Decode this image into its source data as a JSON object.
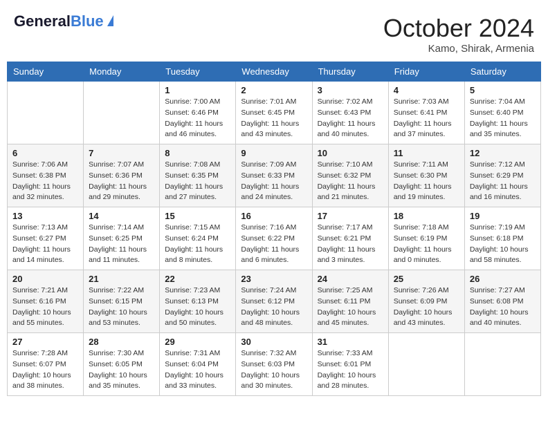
{
  "header": {
    "logo_general": "General",
    "logo_blue": "Blue",
    "month_title": "October 2024",
    "location": "Kamo, Shirak, Armenia"
  },
  "days_of_week": [
    "Sunday",
    "Monday",
    "Tuesday",
    "Wednesday",
    "Thursday",
    "Friday",
    "Saturday"
  ],
  "weeks": [
    [
      {
        "day": "",
        "sunrise": "",
        "sunset": "",
        "daylight": ""
      },
      {
        "day": "",
        "sunrise": "",
        "sunset": "",
        "daylight": ""
      },
      {
        "day": "1",
        "sunrise": "Sunrise: 7:00 AM",
        "sunset": "Sunset: 6:46 PM",
        "daylight": "Daylight: 11 hours and 46 minutes."
      },
      {
        "day": "2",
        "sunrise": "Sunrise: 7:01 AM",
        "sunset": "Sunset: 6:45 PM",
        "daylight": "Daylight: 11 hours and 43 minutes."
      },
      {
        "day": "3",
        "sunrise": "Sunrise: 7:02 AM",
        "sunset": "Sunset: 6:43 PM",
        "daylight": "Daylight: 11 hours and 40 minutes."
      },
      {
        "day": "4",
        "sunrise": "Sunrise: 7:03 AM",
        "sunset": "Sunset: 6:41 PM",
        "daylight": "Daylight: 11 hours and 37 minutes."
      },
      {
        "day": "5",
        "sunrise": "Sunrise: 7:04 AM",
        "sunset": "Sunset: 6:40 PM",
        "daylight": "Daylight: 11 hours and 35 minutes."
      }
    ],
    [
      {
        "day": "6",
        "sunrise": "Sunrise: 7:06 AM",
        "sunset": "Sunset: 6:38 PM",
        "daylight": "Daylight: 11 hours and 32 minutes."
      },
      {
        "day": "7",
        "sunrise": "Sunrise: 7:07 AM",
        "sunset": "Sunset: 6:36 PM",
        "daylight": "Daylight: 11 hours and 29 minutes."
      },
      {
        "day": "8",
        "sunrise": "Sunrise: 7:08 AM",
        "sunset": "Sunset: 6:35 PM",
        "daylight": "Daylight: 11 hours and 27 minutes."
      },
      {
        "day": "9",
        "sunrise": "Sunrise: 7:09 AM",
        "sunset": "Sunset: 6:33 PM",
        "daylight": "Daylight: 11 hours and 24 minutes."
      },
      {
        "day": "10",
        "sunrise": "Sunrise: 7:10 AM",
        "sunset": "Sunset: 6:32 PM",
        "daylight": "Daylight: 11 hours and 21 minutes."
      },
      {
        "day": "11",
        "sunrise": "Sunrise: 7:11 AM",
        "sunset": "Sunset: 6:30 PM",
        "daylight": "Daylight: 11 hours and 19 minutes."
      },
      {
        "day": "12",
        "sunrise": "Sunrise: 7:12 AM",
        "sunset": "Sunset: 6:29 PM",
        "daylight": "Daylight: 11 hours and 16 minutes."
      }
    ],
    [
      {
        "day": "13",
        "sunrise": "Sunrise: 7:13 AM",
        "sunset": "Sunset: 6:27 PM",
        "daylight": "Daylight: 11 hours and 14 minutes."
      },
      {
        "day": "14",
        "sunrise": "Sunrise: 7:14 AM",
        "sunset": "Sunset: 6:25 PM",
        "daylight": "Daylight: 11 hours and 11 minutes."
      },
      {
        "day": "15",
        "sunrise": "Sunrise: 7:15 AM",
        "sunset": "Sunset: 6:24 PM",
        "daylight": "Daylight: 11 hours and 8 minutes."
      },
      {
        "day": "16",
        "sunrise": "Sunrise: 7:16 AM",
        "sunset": "Sunset: 6:22 PM",
        "daylight": "Daylight: 11 hours and 6 minutes."
      },
      {
        "day": "17",
        "sunrise": "Sunrise: 7:17 AM",
        "sunset": "Sunset: 6:21 PM",
        "daylight": "Daylight: 11 hours and 3 minutes."
      },
      {
        "day": "18",
        "sunrise": "Sunrise: 7:18 AM",
        "sunset": "Sunset: 6:19 PM",
        "daylight": "Daylight: 11 hours and 0 minutes."
      },
      {
        "day": "19",
        "sunrise": "Sunrise: 7:19 AM",
        "sunset": "Sunset: 6:18 PM",
        "daylight": "Daylight: 10 hours and 58 minutes."
      }
    ],
    [
      {
        "day": "20",
        "sunrise": "Sunrise: 7:21 AM",
        "sunset": "Sunset: 6:16 PM",
        "daylight": "Daylight: 10 hours and 55 minutes."
      },
      {
        "day": "21",
        "sunrise": "Sunrise: 7:22 AM",
        "sunset": "Sunset: 6:15 PM",
        "daylight": "Daylight: 10 hours and 53 minutes."
      },
      {
        "day": "22",
        "sunrise": "Sunrise: 7:23 AM",
        "sunset": "Sunset: 6:13 PM",
        "daylight": "Daylight: 10 hours and 50 minutes."
      },
      {
        "day": "23",
        "sunrise": "Sunrise: 7:24 AM",
        "sunset": "Sunset: 6:12 PM",
        "daylight": "Daylight: 10 hours and 48 minutes."
      },
      {
        "day": "24",
        "sunrise": "Sunrise: 7:25 AM",
        "sunset": "Sunset: 6:11 PM",
        "daylight": "Daylight: 10 hours and 45 minutes."
      },
      {
        "day": "25",
        "sunrise": "Sunrise: 7:26 AM",
        "sunset": "Sunset: 6:09 PM",
        "daylight": "Daylight: 10 hours and 43 minutes."
      },
      {
        "day": "26",
        "sunrise": "Sunrise: 7:27 AM",
        "sunset": "Sunset: 6:08 PM",
        "daylight": "Daylight: 10 hours and 40 minutes."
      }
    ],
    [
      {
        "day": "27",
        "sunrise": "Sunrise: 7:28 AM",
        "sunset": "Sunset: 6:07 PM",
        "daylight": "Daylight: 10 hours and 38 minutes."
      },
      {
        "day": "28",
        "sunrise": "Sunrise: 7:30 AM",
        "sunset": "Sunset: 6:05 PM",
        "daylight": "Daylight: 10 hours and 35 minutes."
      },
      {
        "day": "29",
        "sunrise": "Sunrise: 7:31 AM",
        "sunset": "Sunset: 6:04 PM",
        "daylight": "Daylight: 10 hours and 33 minutes."
      },
      {
        "day": "30",
        "sunrise": "Sunrise: 7:32 AM",
        "sunset": "Sunset: 6:03 PM",
        "daylight": "Daylight: 10 hours and 30 minutes."
      },
      {
        "day": "31",
        "sunrise": "Sunrise: 7:33 AM",
        "sunset": "Sunset: 6:01 PM",
        "daylight": "Daylight: 10 hours and 28 minutes."
      },
      {
        "day": "",
        "sunrise": "",
        "sunset": "",
        "daylight": ""
      },
      {
        "day": "",
        "sunrise": "",
        "sunset": "",
        "daylight": ""
      }
    ]
  ]
}
